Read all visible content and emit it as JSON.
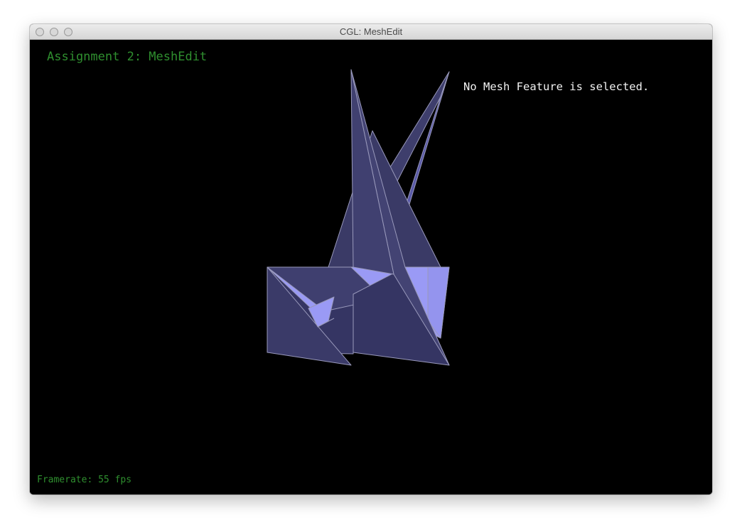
{
  "window": {
    "title": "CGL: MeshEdit"
  },
  "overlay": {
    "heading": "Assignment 2: MeshEdit",
    "selection_status": "No Mesh Feature is selected.",
    "framerate_label": "Framerate:",
    "framerate_value": "55 fps"
  },
  "colors": {
    "background": "#000000",
    "heading_text": "#2f8f2f",
    "status_text": "#f2f2f2",
    "mesh_face_dark": "#353563",
    "mesh_face_mid": "#434373",
    "mesh_face_light": "#5a5aa8",
    "mesh_face_lit": "#9a9af5",
    "mesh_edge": "#9999bb"
  },
  "icons": {
    "close": "close-button-icon",
    "minimize": "minimize-button-icon",
    "zoom": "zoom-button-icon"
  }
}
